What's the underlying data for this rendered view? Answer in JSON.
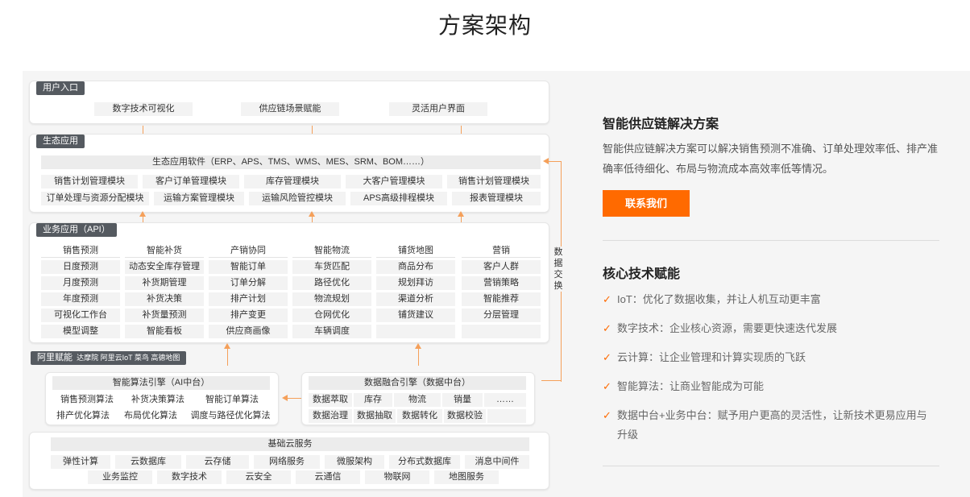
{
  "page": {
    "title": "方案架构"
  },
  "diagram": {
    "user_entry": {
      "tag": "用户入口",
      "items": [
        "数字技术可视化",
        "供应链场景赋能",
        "灵活用户界面"
      ]
    },
    "eco": {
      "tag": "生态应用",
      "header": "生态应用软件（ERP、APS、TMS、WMS、MES、SRM、BOM……）",
      "row1": [
        "销售计划管理模块",
        "客户订单管理模块",
        "库存管理模块",
        "大客户管理模块",
        "销售计划管理模块"
      ],
      "row2": [
        "订单处理与资源分配模块",
        "运输方案管理模块",
        "运输风险管控模块",
        "APS高级排程模块",
        "报表管理模块"
      ]
    },
    "biz": {
      "tag": "业务应用（API）",
      "columns": [
        {
          "head": "销售预测",
          "items": [
            "日度预测",
            "月度预测",
            "年度预测",
            "可视化工作台",
            "模型调整"
          ]
        },
        {
          "head": "智能补货",
          "items": [
            "动态安全库存管理",
            "补货期管理",
            "补货决策",
            "补货量预测",
            "智能看板"
          ]
        },
        {
          "head": "产销协同",
          "items": [
            "智能订单",
            "订单分解",
            "排产计划",
            "排产变更",
            "供应商画像"
          ]
        },
        {
          "head": "智能物流",
          "items": [
            "车货匹配",
            "路径优化",
            "物流规划",
            "仓网优化",
            "车辆调度"
          ]
        },
        {
          "head": "铺货地图",
          "items": [
            "商品分布",
            "规划拜访",
            "渠道分析",
            "铺货建议",
            ""
          ]
        },
        {
          "head": "营销",
          "items": [
            "客户人群",
            "营销策略",
            "智能推荐",
            "分层管理",
            ""
          ]
        }
      ],
      "exchange": "数据交换"
    },
    "ali": {
      "tag": "阿里赋能",
      "tag_sub": "达摩院 阿里云IoT 菜鸟 高德地图",
      "algo": {
        "head": "智能算法引擎（AI中台）",
        "row1": [
          "销售预测算法",
          "补货决策算法",
          "智能订单算法"
        ],
        "row2": [
          "排产优化算法",
          "布局优化算法",
          "调度与路径优化算法"
        ]
      },
      "data": {
        "head": "数据融合引擎（数据中台）",
        "row1": [
          "数据萃取",
          "库存",
          "物流",
          "销量",
          "……"
        ],
        "row2": [
          "数据治理",
          "数据抽取",
          "数据转化",
          "数据校验",
          ""
        ]
      },
      "cloud": {
        "head": "基础云服务",
        "row1": [
          "弹性计算",
          "云数据库",
          "云存储",
          "网络服务",
          "微服架构",
          "分布式数据库",
          "消息中间件"
        ],
        "row2": [
          "业务监控",
          "数字技术",
          "云安全",
          "云通信",
          "物联网",
          "地图服务"
        ]
      }
    }
  },
  "panel": {
    "title": "智能供应链解决方案",
    "desc": "智能供应链解决方案可以解决销售预测不准确、订单处理效率低、排产准确率低待细化、布局与物流成本高效率低等情况。",
    "button": "联系我们",
    "core_title": "核心技术赋能",
    "features": [
      "IoT：优化了数据收集，并让人机互动更丰富",
      "数字技术：企业核心资源，需要更快速迭代发展",
      "云计算：让企业管理和计算实现质的飞跃",
      "智能算法：让商业智能成为可能",
      "数据中台+业务中台：赋予用户更高的灵活性，让新技术更易应用与升级"
    ],
    "accent": "#ff6a00"
  }
}
